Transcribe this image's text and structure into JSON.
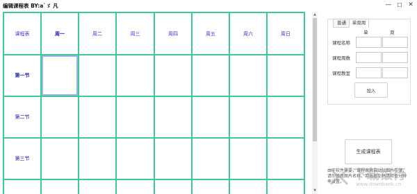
{
  "window": {
    "title": "编辑课程表  BY:a`ゞ 凡",
    "minimize_glyph": "—",
    "maximize_glyph": "☐",
    "close_glyph": "✕"
  },
  "timetable": {
    "corner_label": "课程表",
    "days": [
      "周一",
      "周二",
      "周三",
      "周四",
      "周五",
      "周六",
      "周日"
    ],
    "active_day_index": 0,
    "periods": [
      "第一节",
      "第二节",
      "第三节"
    ],
    "active_period_index": 0,
    "selected_cell": {
      "row": 0,
      "col": 0
    },
    "line_color": "#3ec79b",
    "header_text_color": "#3a3ad6"
  },
  "panel": {
    "tabs": [
      "普通",
      "单双周"
    ],
    "active_tab_index": 1,
    "col_single": "单",
    "col_double": "双",
    "fields": [
      {
        "label": "课程名称",
        "single_value": "",
        "double_value": ""
      },
      {
        "label": "课程周数",
        "single_value": "",
        "double_value": ""
      },
      {
        "label": "课程教室",
        "single_value": "",
        "double_value": ""
      }
    ],
    "add_button": "加入"
  },
  "generate_button": "生成课程表",
  "note": "由于软件需要，课程表将自动以图片存储，请勿修改图片名称。若出现乱码请检查分辨率设置。",
  "watermark": {
    "brand": "下载银行",
    "url": "www.downbank.cn"
  }
}
